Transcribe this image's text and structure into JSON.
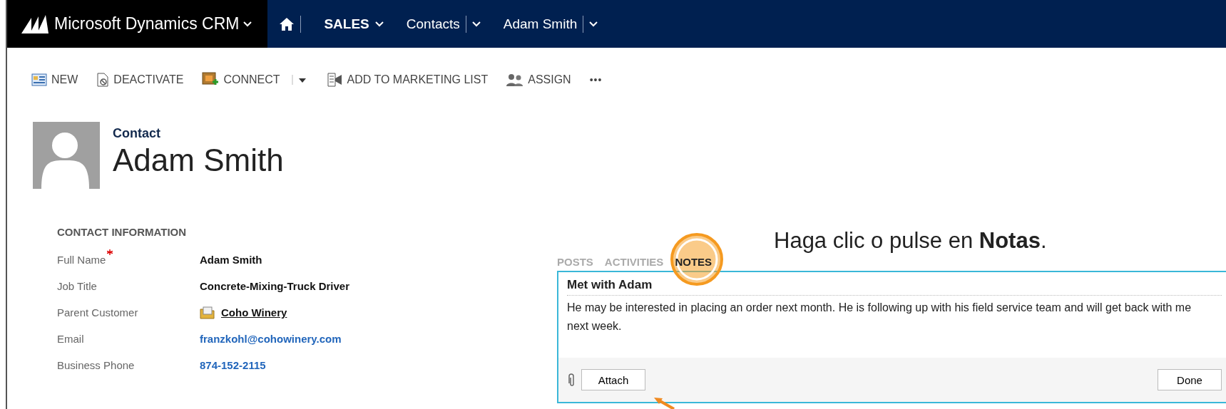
{
  "nav_bar": {
    "brand": "Microsoft Dynamics CRM",
    "items": [
      {
        "kind": "home"
      },
      {
        "kind": "area",
        "label": "SALES"
      },
      {
        "kind": "crumb",
        "label": "Contacts"
      },
      {
        "kind": "crumb",
        "label": "Adam Smith"
      }
    ]
  },
  "command_bar": [
    {
      "kind": "new",
      "label": "NEW"
    },
    {
      "kind": "deactivate",
      "label": "DEACTIVATE"
    },
    {
      "kind": "connect",
      "label": "CONNECT"
    },
    {
      "kind": "marketing",
      "label": "ADD TO MARKETING LIST"
    },
    {
      "kind": "assign",
      "label": "ASSIGN"
    },
    {
      "kind": "more",
      "label": "•••"
    }
  ],
  "header": {
    "entity": "Contact",
    "name": "Adam Smith"
  },
  "contact_information": {
    "title": "CONTACT INFORMATION",
    "fields": [
      {
        "label": "Full Name",
        "required": true,
        "value": "Adam Smith",
        "kind": "text"
      },
      {
        "label": "Job Title",
        "required": false,
        "value": "Concrete-Mixing-Truck Driver",
        "kind": "text"
      },
      {
        "label": "Parent Customer",
        "required": false,
        "value": "Coho Winery",
        "kind": "lookup"
      },
      {
        "label": "Email",
        "required": false,
        "value": "franzkohl@cohowinery.com",
        "kind": "link"
      },
      {
        "label": "Business Phone",
        "required": false,
        "value": "874-152-2115",
        "kind": "link"
      }
    ]
  },
  "social_pane": {
    "tabs": [
      {
        "label": "POSTS",
        "selected": false
      },
      {
        "label": "ACTIVITIES",
        "selected": false
      },
      {
        "label": "NOTES",
        "selected": true
      }
    ],
    "note": {
      "title": "Met with Adam",
      "text": "He may be interested in placing an order next month. He is following up with his field service team and will get back with me next week."
    },
    "buttons": [
      "Attach",
      "Done"
    ]
  },
  "callout": "Haga clic o pulse en **Notas**."
}
